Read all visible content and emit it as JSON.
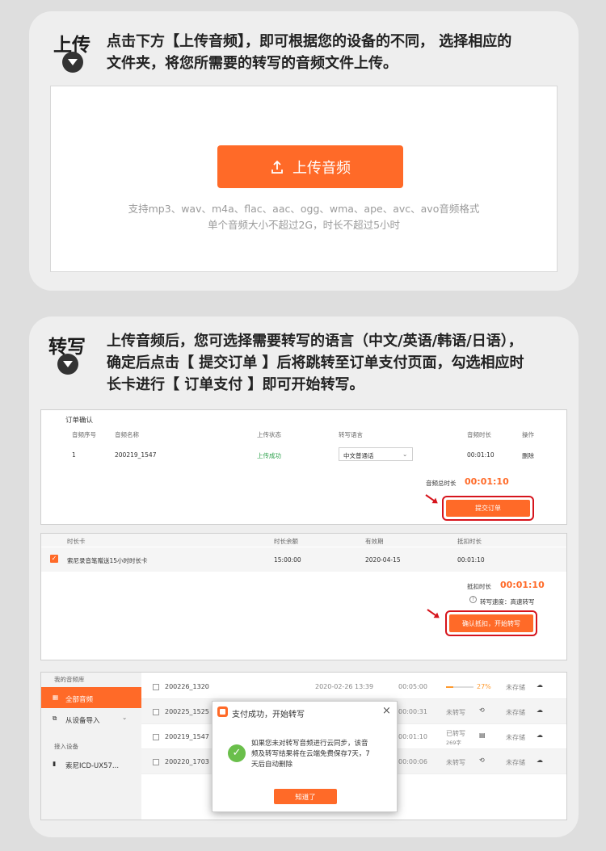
{
  "upload_section": {
    "title": "上传",
    "description_line1": "点击下方【上传音频】，即可根据您的设备的不同， 选择相应的",
    "description_line2": "文件夹，将您所需要的转写的音频文件上传。",
    "upload_button_label": "上传音频",
    "formats_hint": "支持mp3、wav、m4a、flac、aac、ogg、wma、ape、avc、avo音频格式",
    "limit_hint": "单个音频大小不超过2G，时长不超过5小时"
  },
  "transcribe_section": {
    "title": "转写",
    "description_line1": "上传音频后，您可选择需要转写的语言（中文/英语/韩语/日语），",
    "description_line2": "确定后点击【 提交订单 】后将跳转至订单支付页面，勾选相应时",
    "description_line3": "长卡进行【 订单支付 】即可开始转写。"
  },
  "order_confirm": {
    "heading": "订单确认",
    "columns": [
      "音频序号",
      "音频名称",
      "上传状态",
      "转写语言",
      "音频时长",
      "操作"
    ],
    "row": {
      "index": "1",
      "name": "200219_1547",
      "status": "上传成功",
      "language": "中文普通话",
      "duration": "00:01:10",
      "action": "删除"
    },
    "total_label": "音频总时长",
    "total_value": "00:01:10",
    "submit_label": "提交订单"
  },
  "payment": {
    "columns": [
      "时长卡",
      "时长余额",
      "有效期",
      "抵扣时长"
    ],
    "row": {
      "card": "索尼录音笔赠送15小时时长卡",
      "balance": "15:00:00",
      "expiry": "2020-04-15",
      "deduct": "00:01:10"
    },
    "deduct_label": "抵扣时长",
    "deduct_value": "00:01:10",
    "speed_label": "转写速度：高速转写",
    "confirm_label": "确认抵扣，开始转写"
  },
  "library": {
    "heading": "我的音频库",
    "nav_all": "全部音频",
    "nav_import": "从设备导入",
    "devices_heading": "接入设备",
    "device_name": "索尼ICD-UX57...",
    "rows": [
      {
        "name": "200226_1320",
        "date": "2020-02-26  13:39",
        "duration": "00:05:00",
        "progress": "27%",
        "storage": "未存储"
      },
      {
        "name": "200225_1525",
        "duration": "00:00:31",
        "status": "未转写",
        "storage": "未存储"
      },
      {
        "name": "200219_1547",
        "duration": "00:01:10",
        "status": "已转写",
        "words": "269字",
        "storage": "未存储"
      },
      {
        "name": "200220_1703",
        "duration": "00:00:06",
        "status": "未转写",
        "storage": "未存储"
      }
    ],
    "progress_fraction": 0.27
  },
  "dialog": {
    "title": "支付成功，开始转写",
    "close_icon": "×",
    "message_line1": "如果您未对转写音频进行云同步，该音",
    "message_line2": "频及转写结果将在云端免费保存7天，7",
    "message_line3": "天后自动删除",
    "ok_label": "知道了"
  },
  "colors": {
    "accent": "#ff6a28",
    "highlight": "#d6141c",
    "success": "#2ba04a"
  }
}
